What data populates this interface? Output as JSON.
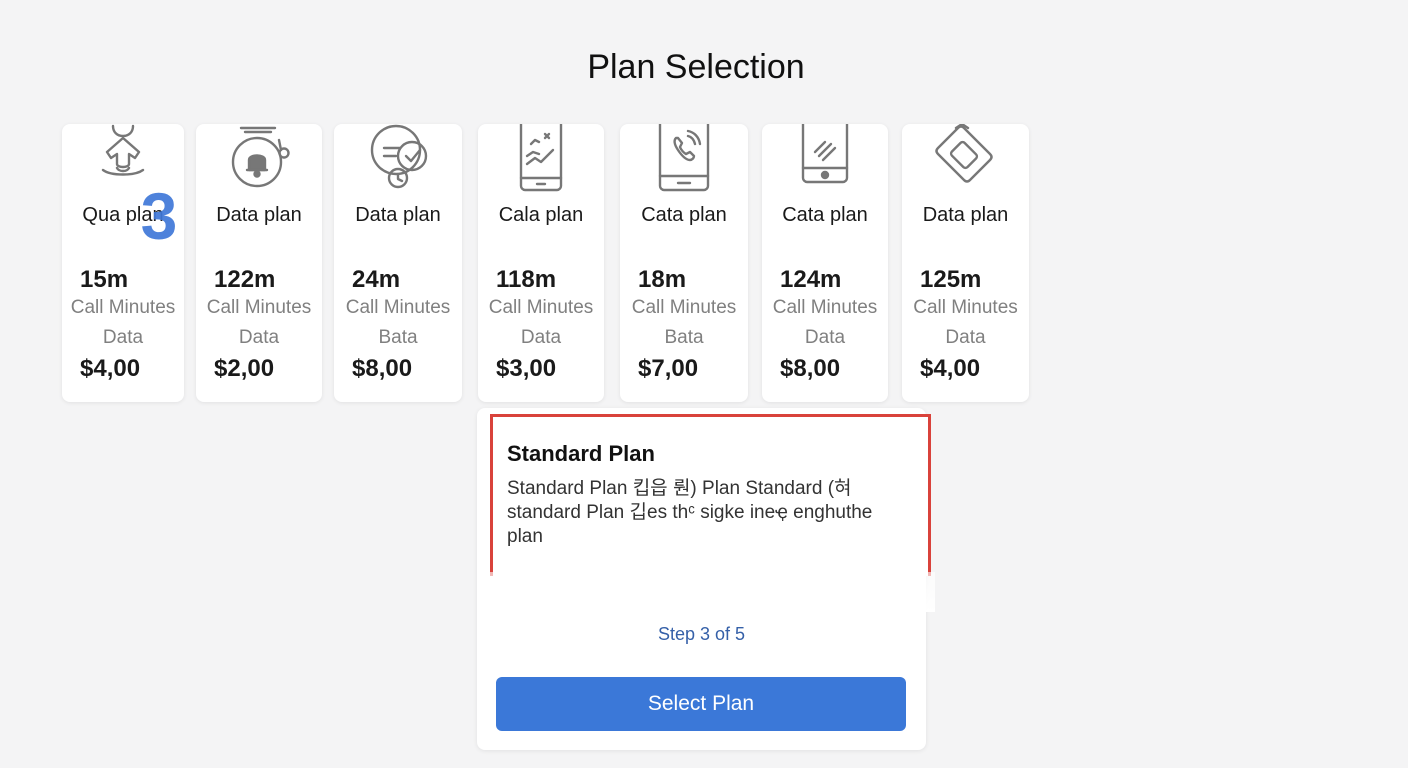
{
  "page": {
    "title": "Plan Selection"
  },
  "plans": [
    {
      "icon": "person-signal-icon",
      "name": "Qua plan",
      "minutes": "15m",
      "minutes_label": "Call Minutes",
      "data_label": "Data",
      "price": "$4,00"
    },
    {
      "icon": "bell-stopwatch-icon",
      "name": "Data plan",
      "minutes": "122m",
      "minutes_label": "Call Minutes",
      "data_label": "Data",
      "price": "$2,00"
    },
    {
      "icon": "chat-check-icon",
      "name": "Data plan",
      "minutes": "24m",
      "minutes_label": "Call Minutes",
      "data_label": "Bata",
      "price": "$8,00"
    },
    {
      "icon": "phone-chart-icon",
      "name": "Cala plan",
      "minutes": "118m",
      "minutes_label": "Call Minutes",
      "data_label": "Data",
      "price": "$3,00"
    },
    {
      "icon": "phone-call-icon",
      "name": "Cata plan",
      "minutes": "18m",
      "minutes_label": "Call Minutes",
      "data_label": "Bata",
      "price": "$7,00"
    },
    {
      "icon": "phone-signal-icon",
      "name": "Cata plan",
      "minutes": "124m",
      "minutes_label": "Call Minutes",
      "data_label": "Data",
      "price": "$8,00"
    },
    {
      "icon": "sim-card-icon",
      "name": "Data plan",
      "minutes": "125m",
      "minutes_label": "Call Minutes",
      "data_label": "Data",
      "price": "$4,00"
    }
  ],
  "step_badge": "3",
  "detail": {
    "title": "Standard Plan",
    "description": "Standard Plan 킵읍 뤈) Plan Standard (혀 standard Plan 깁es thᶜ sigke ineҿ enghuthe plan",
    "step": "Step 3 of 5",
    "button_label": "Select Plan"
  },
  "colors": {
    "accent": "#3b78d8",
    "highlight_border": "#d9423b",
    "step_text": "#3560a8",
    "background": "#f4f4f5"
  }
}
